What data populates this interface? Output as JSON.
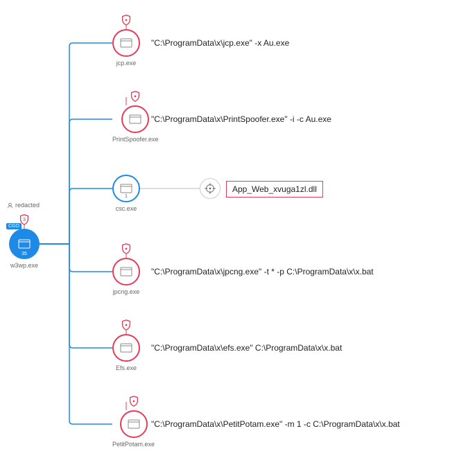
{
  "root": {
    "label": "w3wp.exe",
    "count": "35",
    "tag": "CGO",
    "user": "redacted",
    "shield_count": "3"
  },
  "children": [
    {
      "label": "jcp.exe",
      "cmd": "\"C:\\ProgramData\\x\\jcp.exe\"  -x Au.exe",
      "type": "red"
    },
    {
      "label": "PrintSpoofer.exe",
      "cmd": "\"C:\\ProgramData\\x\\PrintSpoofer.exe\"  -i -c Au.exe",
      "type": "red"
    },
    {
      "label": "csc.exe",
      "count": "1",
      "type": "blue",
      "dll": "App_Web_xvuga1zl.dll"
    },
    {
      "label": "jpcng.exe",
      "cmd": "\"C:\\ProgramData\\x\\jpcng.exe\" -t * -p C:\\ProgramData\\x\\x.bat",
      "type": "red"
    },
    {
      "label": "Efs.exe",
      "cmd": "\"C:\\ProgramData\\x\\efs.exe\" C:\\ProgramData\\x\\x.bat",
      "type": "red"
    },
    {
      "label": "PetitPotam.exe",
      "cmd": "\"C:\\ProgramData\\x\\PetitPotam.exe\" -m 1 -c C:\\ProgramData\\x\\x.bat",
      "type": "red"
    }
  ]
}
